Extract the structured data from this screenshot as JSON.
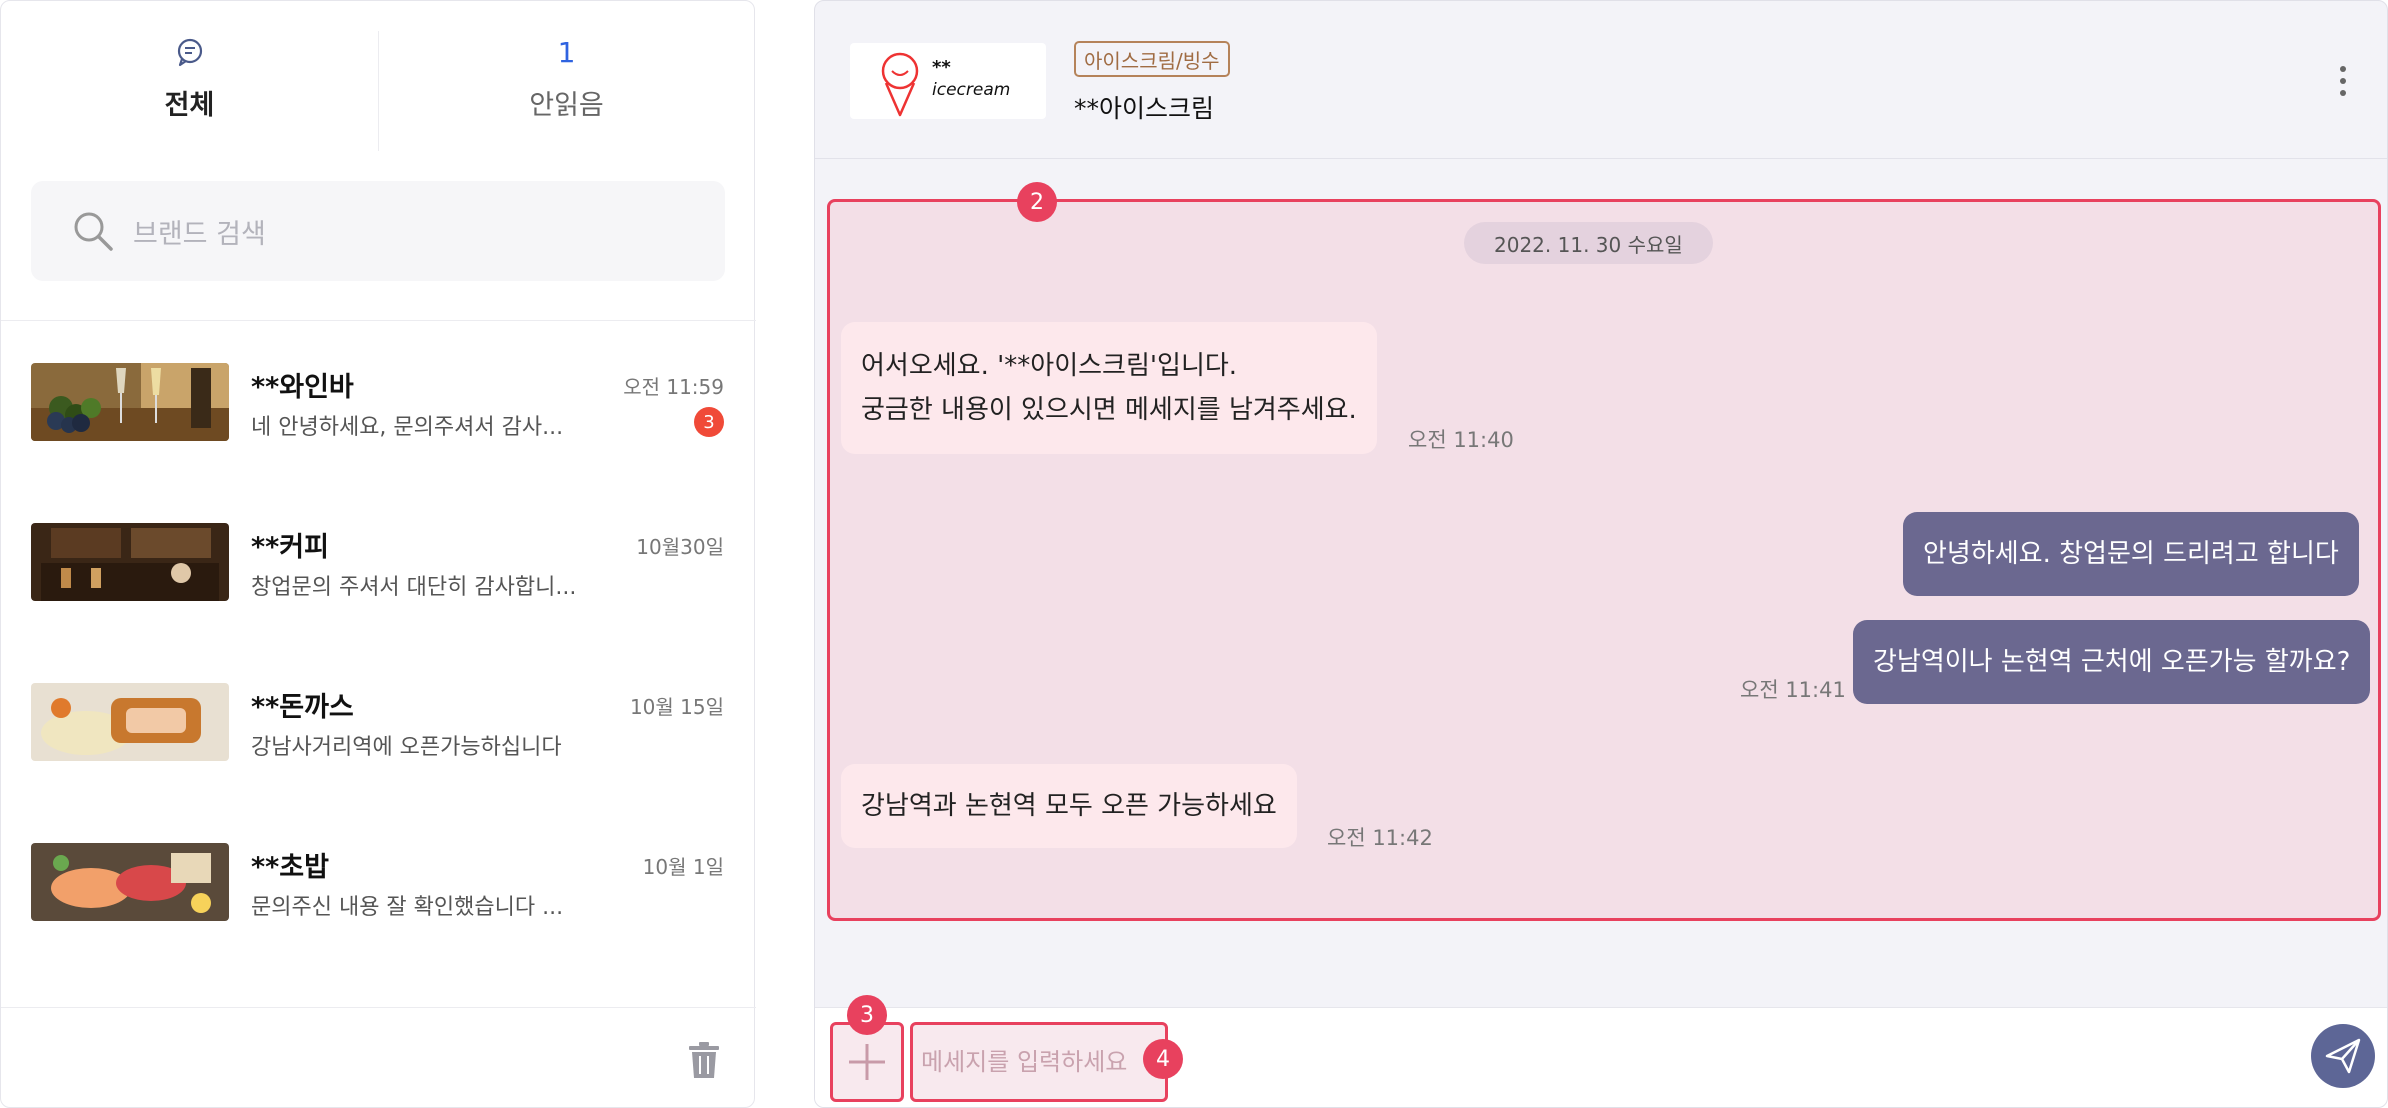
{
  "tabs": [
    {
      "label": "전체",
      "icon": "chat-bubble-icon"
    },
    {
      "label": "안읽음",
      "count": "1"
    }
  ],
  "search": {
    "placeholder": "브랜드 검색"
  },
  "conversations": [
    {
      "name": "**와인바",
      "time": "오전 11:59",
      "preview": "네 안녕하세요, 문의주셔서 감사...",
      "unread": "3"
    },
    {
      "name": "**커피",
      "time": "10월30일",
      "preview": "창업문의 주셔서 대단히 감사합니..."
    },
    {
      "name": "**돈까스",
      "time": "10월 15일",
      "preview": "강남사거리역에 오픈가능하십니다"
    },
    {
      "name": "**초밥",
      "time": "10월 1일",
      "preview": "문의주신 내용 잘 확인했습니다 ..."
    }
  ],
  "chat": {
    "category": "아이스크림/빙수",
    "shop_name": "**아이스크림",
    "logo_text_1": "**",
    "logo_text_2": "icecream",
    "date": "2022. 11. 30 수요일",
    "messages": [
      {
        "from": "shop",
        "lines": [
          "어서오세요. '**아이스크림'입니다.",
          "궁금한 내용이 있으시면 메세지를 남겨주세요."
        ],
        "time": "오전 11:40"
      },
      {
        "from": "me",
        "text": "안녕하세요. 창업문의 드리려고 합니다"
      },
      {
        "from": "me",
        "text": "강남역이나 논현역 근처에 오픈가능 할까요?",
        "time": "오전 11:41"
      },
      {
        "from": "shop",
        "text": "강남역과 논현역 모두 오픈 가능하세요",
        "time": "오전 11:42"
      }
    ],
    "input_placeholder": "메세지를 입력하세요"
  },
  "markers": {
    "chat_area": "2",
    "attach": "3",
    "input": "4"
  },
  "colors": {
    "accent": "#e8415e",
    "bubble_out": "#6b6890",
    "bubble_in": "#fde8ec",
    "link": "#2f63e0"
  }
}
